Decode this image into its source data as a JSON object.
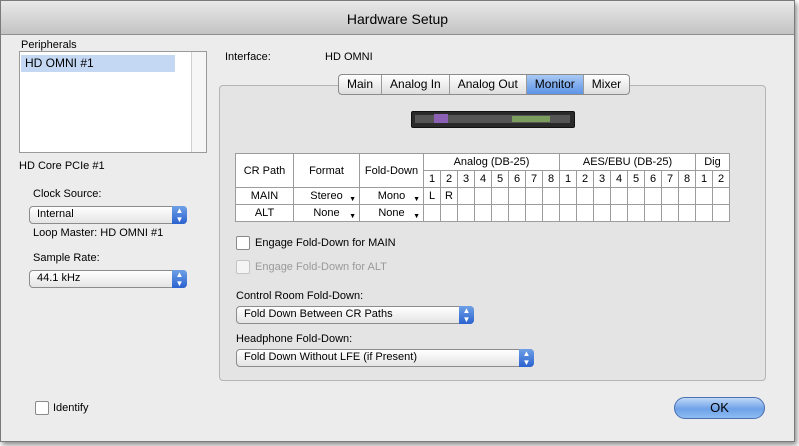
{
  "window": {
    "title": "Hardware Setup"
  },
  "sidebar": {
    "peripherals_label": "Peripherals",
    "peripherals": [
      "HD OMNI #1"
    ],
    "card_label": "HD Core PCIe #1",
    "clock_source_label": "Clock Source:",
    "clock_source_value": "Internal",
    "loop_master": "Loop Master: HD OMNI #1",
    "sample_rate_label": "Sample Rate:",
    "sample_rate_value": "44.1 kHz",
    "identify_label": "Identify"
  },
  "interface": {
    "label": "Interface:",
    "value": "HD OMNI"
  },
  "tabs": [
    {
      "label": "Main",
      "selected": false
    },
    {
      "label": "Analog In",
      "selected": false
    },
    {
      "label": "Analog Out",
      "selected": false
    },
    {
      "label": "Monitor",
      "selected": true
    },
    {
      "label": "Mixer",
      "selected": false
    }
  ],
  "routing_table": {
    "headers": {
      "cr_path": "CR Path",
      "format": "Format",
      "fold_down": "Fold-Down"
    },
    "groups": [
      {
        "label": "Analog (DB-25)",
        "channels": [
          "1",
          "2",
          "3",
          "4",
          "5",
          "6",
          "7",
          "8"
        ]
      },
      {
        "label": "AES/EBU (DB-25)",
        "channels": [
          "1",
          "2",
          "3",
          "4",
          "5",
          "6",
          "7",
          "8"
        ]
      },
      {
        "label": "Dig",
        "channels": [
          "1",
          "2"
        ]
      }
    ],
    "rows": [
      {
        "path": "MAIN",
        "format": "Stereo",
        "fold_down": "Mono",
        "assign": [
          "L",
          "R",
          "",
          "",
          "",
          "",
          "",
          "",
          "",
          "",
          "",
          "",
          "",
          "",
          "",
          "",
          "",
          ""
        ]
      },
      {
        "path": "ALT",
        "format": "None",
        "fold_down": "None",
        "assign": [
          "",
          "",
          "",
          "",
          "",
          "",
          "",
          "",
          "",
          "",
          "",
          "",
          "",
          "",
          "",
          "",
          "",
          ""
        ]
      }
    ]
  },
  "options": {
    "engage_main": "Engage Fold-Down for MAIN",
    "engage_alt": "Engage Fold-Down for ALT",
    "control_room_label": "Control Room Fold-Down:",
    "control_room_value": "Fold Down Between CR Paths",
    "headphone_label": "Headphone Fold-Down:",
    "headphone_value": "Fold Down Without LFE (if Present)"
  },
  "ok_label": "OK",
  "colors": {
    "accent": "#4a86e0",
    "selection": "#c4d7f3",
    "window_bg": "#ececec"
  }
}
